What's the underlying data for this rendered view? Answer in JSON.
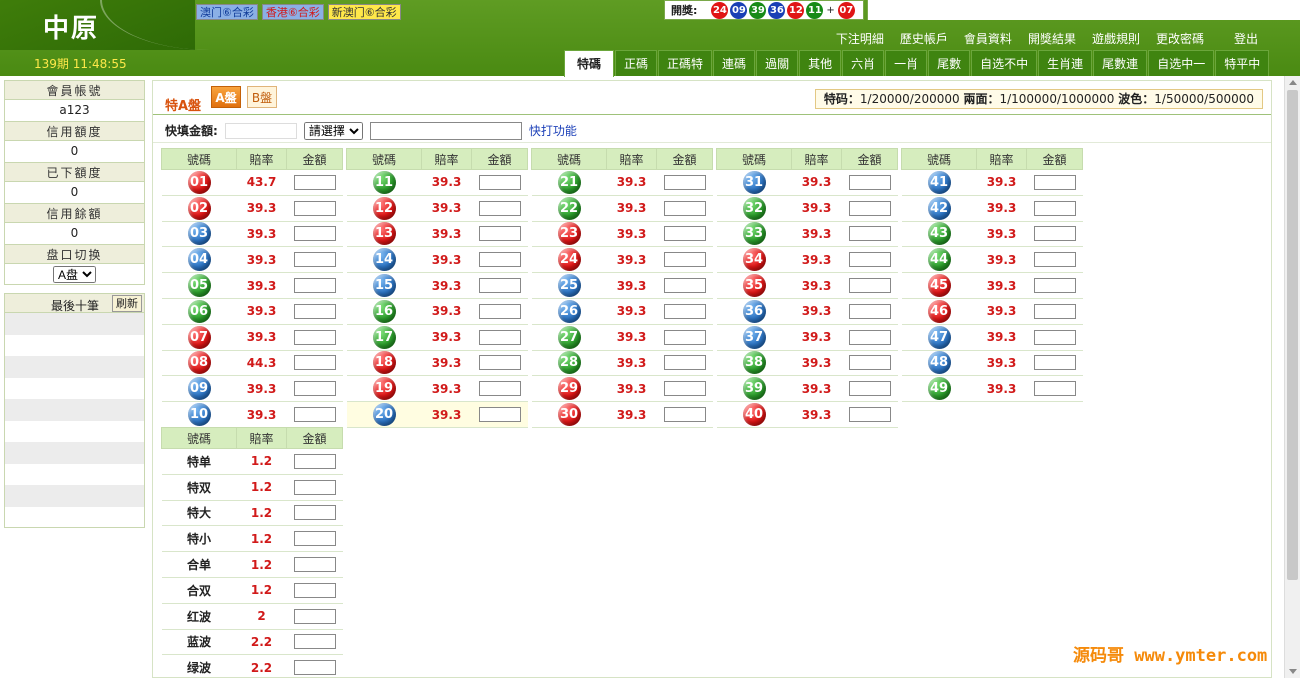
{
  "app": {
    "logo": "中原",
    "period": "139期 11:48:55"
  },
  "lottery_tabs": [
    {
      "label": "澳门⑥合彩",
      "style": "blue"
    },
    {
      "label": "香港⑥合彩",
      "style": "red"
    },
    {
      "label": "新澳门⑥合彩",
      "style": "yellow"
    }
  ],
  "draw": {
    "label": "開獎:",
    "balls": [
      {
        "num": "24",
        "color": "#e01515"
      },
      {
        "num": "09",
        "color": "#1a3fb5"
      },
      {
        "num": "39",
        "color": "#178a17"
      },
      {
        "num": "36",
        "color": "#1a3fb5"
      },
      {
        "num": "12",
        "color": "#e01515"
      },
      {
        "num": "11",
        "color": "#178a17"
      }
    ],
    "plus": "+",
    "special": {
      "num": "07",
      "color": "#e01515"
    }
  },
  "top_links": [
    "下注明細",
    "歷史帳戶",
    "會員資料",
    "開獎結果",
    "遊戲規則",
    "更改密碼"
  ],
  "logout": "登出",
  "bet_tabs": [
    "特碼",
    "正碼",
    "正碼特",
    "連碼",
    "過關",
    "其他",
    "六肖",
    "一肖",
    "尾數",
    "自选不中",
    "生肖連",
    "尾數連",
    "自选中一",
    "特平中"
  ],
  "sidebar": {
    "account_label": "會員帳號",
    "account": "a123",
    "credit_label": "信用額度",
    "credit": "0",
    "placed_label": "已下額度",
    "placed": "0",
    "balance_label": "信用餘額",
    "balance": "0",
    "switch_label": "盘口切换",
    "switch_value": "A盘",
    "last_ten_label": "最後十筆",
    "refresh": "刷新"
  },
  "panel": {
    "title": "特A盤",
    "btn_a": "A盤",
    "btn_b": "B盤",
    "rates": {
      "k1": "特码：",
      "v1": "1/20000/200000",
      "k2": "兩面：",
      "v2": "1/100000/1000000",
      "k3": "波色：",
      "v3": "1/50000/500000"
    }
  },
  "quick": {
    "label": "快填金額:",
    "select": "請選擇",
    "link": "快打功能"
  },
  "headers": {
    "num": "號碼",
    "rate": "賠率",
    "amount": "金額"
  },
  "columns": [
    [
      {
        "n": "01",
        "c": "red",
        "r": "43.7"
      },
      {
        "n": "02",
        "c": "red",
        "r": "39.3"
      },
      {
        "n": "03",
        "c": "blue",
        "r": "39.3"
      },
      {
        "n": "04",
        "c": "blue",
        "r": "39.3"
      },
      {
        "n": "05",
        "c": "green",
        "r": "39.3"
      },
      {
        "n": "06",
        "c": "green",
        "r": "39.3"
      },
      {
        "n": "07",
        "c": "red",
        "r": "39.3"
      },
      {
        "n": "08",
        "c": "red",
        "r": "44.3"
      },
      {
        "n": "09",
        "c": "blue",
        "r": "39.3"
      },
      {
        "n": "10",
        "c": "blue",
        "r": "39.3"
      }
    ],
    [
      {
        "n": "11",
        "c": "green",
        "r": "39.3"
      },
      {
        "n": "12",
        "c": "red",
        "r": "39.3"
      },
      {
        "n": "13",
        "c": "red",
        "r": "39.3"
      },
      {
        "n": "14",
        "c": "blue",
        "r": "39.3"
      },
      {
        "n": "15",
        "c": "blue",
        "r": "39.3"
      },
      {
        "n": "16",
        "c": "green",
        "r": "39.3"
      },
      {
        "n": "17",
        "c": "green",
        "r": "39.3"
      },
      {
        "n": "18",
        "c": "red",
        "r": "39.3"
      },
      {
        "n": "19",
        "c": "red",
        "r": "39.3"
      },
      {
        "n": "20",
        "c": "blue",
        "r": "39.3",
        "hl": true
      }
    ],
    [
      {
        "n": "21",
        "c": "green",
        "r": "39.3"
      },
      {
        "n": "22",
        "c": "green",
        "r": "39.3"
      },
      {
        "n": "23",
        "c": "red",
        "r": "39.3"
      },
      {
        "n": "24",
        "c": "red",
        "r": "39.3"
      },
      {
        "n": "25",
        "c": "blue",
        "r": "39.3"
      },
      {
        "n": "26",
        "c": "blue",
        "r": "39.3"
      },
      {
        "n": "27",
        "c": "green",
        "r": "39.3"
      },
      {
        "n": "28",
        "c": "green",
        "r": "39.3"
      },
      {
        "n": "29",
        "c": "red",
        "r": "39.3"
      },
      {
        "n": "30",
        "c": "red",
        "r": "39.3"
      }
    ],
    [
      {
        "n": "31",
        "c": "blue",
        "r": "39.3"
      },
      {
        "n": "32",
        "c": "green",
        "r": "39.3"
      },
      {
        "n": "33",
        "c": "green",
        "r": "39.3"
      },
      {
        "n": "34",
        "c": "red",
        "r": "39.3"
      },
      {
        "n": "35",
        "c": "red",
        "r": "39.3"
      },
      {
        "n": "36",
        "c": "blue",
        "r": "39.3"
      },
      {
        "n": "37",
        "c": "blue",
        "r": "39.3"
      },
      {
        "n": "38",
        "c": "green",
        "r": "39.3"
      },
      {
        "n": "39",
        "c": "green",
        "r": "39.3"
      },
      {
        "n": "40",
        "c": "red",
        "r": "39.3"
      }
    ],
    [
      {
        "n": "41",
        "c": "blue",
        "r": "39.3"
      },
      {
        "n": "42",
        "c": "blue",
        "r": "39.3"
      },
      {
        "n": "43",
        "c": "green",
        "r": "39.3"
      },
      {
        "n": "44",
        "c": "green",
        "r": "39.3"
      },
      {
        "n": "45",
        "c": "red",
        "r": "39.3"
      },
      {
        "n": "46",
        "c": "red",
        "r": "39.3"
      },
      {
        "n": "47",
        "c": "blue",
        "r": "39.3"
      },
      {
        "n": "48",
        "c": "blue",
        "r": "39.3"
      },
      {
        "n": "49",
        "c": "green",
        "r": "39.3"
      }
    ]
  ],
  "twosides": [
    {
      "l": "特单",
      "r": "1.2"
    },
    {
      "l": "特双",
      "r": "1.2"
    },
    {
      "l": "特大",
      "r": "1.2"
    },
    {
      "l": "特小",
      "r": "1.2"
    },
    {
      "l": "合单",
      "r": "1.2"
    },
    {
      "l": "合双",
      "r": "1.2"
    },
    {
      "l": "红波",
      "r": "2"
    },
    {
      "l": "蓝波",
      "r": "2.2"
    },
    {
      "l": "绿波",
      "r": "2.2"
    }
  ],
  "watermark": "源码哥 www.ymter.com"
}
